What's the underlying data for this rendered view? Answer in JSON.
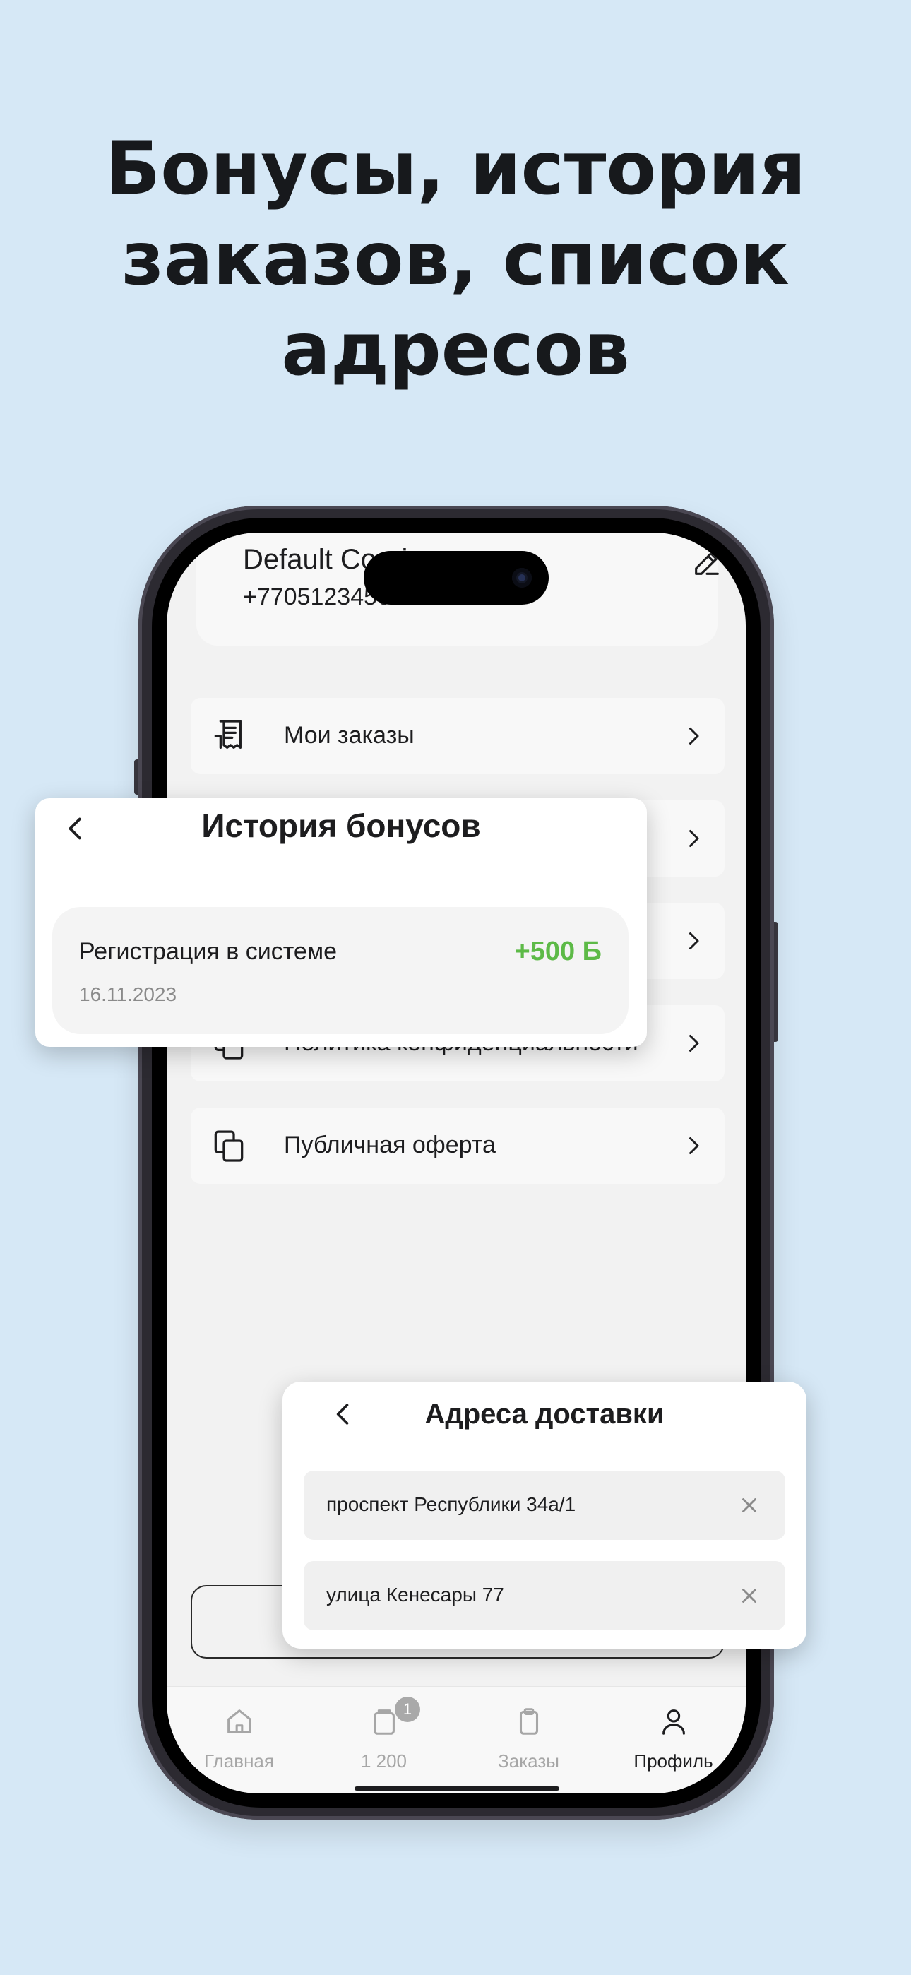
{
  "headline": {
    "line1": "Бонусы, история",
    "line2": "заказов, список",
    "line3": "адресов"
  },
  "profile": {
    "name": "Default Couri",
    "phone": "+7705123456"
  },
  "menu": {
    "items": [
      {
        "label": "Мои заказы",
        "icon": "receipt-icon"
      },
      {
        "label": "",
        "icon": ""
      },
      {
        "label": "",
        "icon": ""
      },
      {
        "label": "Политика конфиденциальности",
        "icon": "copy-icon"
      },
      {
        "label": "Публичная оферта",
        "icon": "copy-icon"
      }
    ]
  },
  "bonus_history": {
    "title": "История бонусов",
    "entry": {
      "title": "Регистрация в системе",
      "date": "16.11.2023",
      "amount": "+500 Б"
    }
  },
  "addresses": {
    "title": "Адреса доставки",
    "items": [
      "проспект Республики 34а/1",
      "улица Кенесары 77"
    ]
  },
  "tabbar": {
    "tabs": [
      {
        "label": "Главная",
        "icon": "home-icon"
      },
      {
        "label": "1 200",
        "icon": "bonus-card-icon",
        "badge": "1"
      },
      {
        "label": "Заказы",
        "icon": "clipboard-icon"
      },
      {
        "label": "Профиль",
        "icon": "user-icon",
        "active": true
      }
    ]
  },
  "colors": {
    "background": "#d6e8f6",
    "bonus_green": "#5dba47",
    "screen": "#f2f2f2"
  }
}
